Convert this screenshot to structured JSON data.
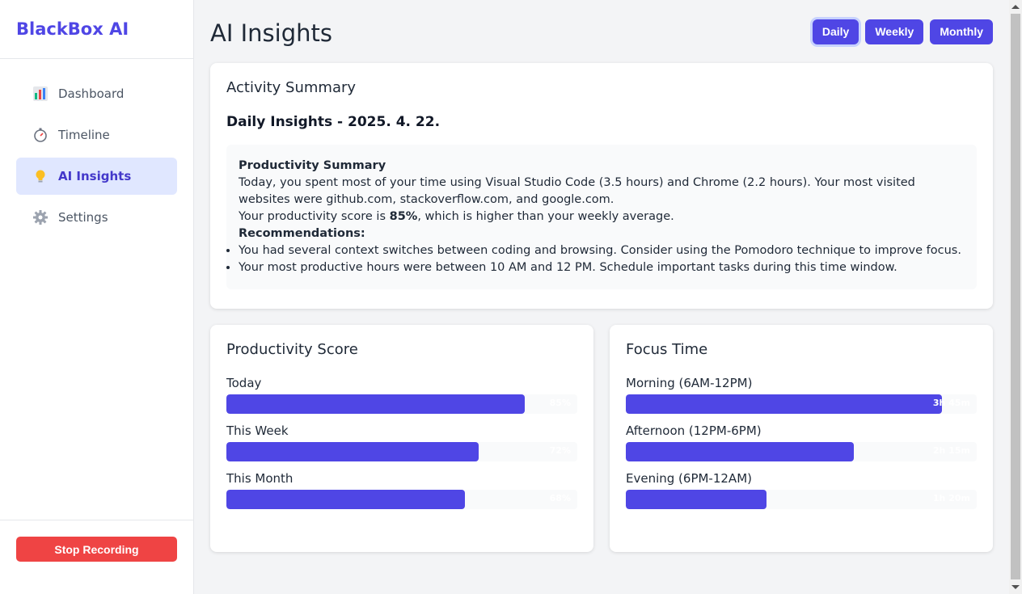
{
  "app": {
    "brand": "BlackBox AI"
  },
  "sidebar": {
    "items": [
      {
        "label": "Dashboard",
        "icon": "chart-icon",
        "active": false
      },
      {
        "label": "Timeline",
        "icon": "stopwatch-icon",
        "active": false
      },
      {
        "label": "AI Insights",
        "icon": "lightbulb-icon",
        "active": true
      },
      {
        "label": "Settings",
        "icon": "gear-icon",
        "active": false
      }
    ],
    "stop_label": "Stop Recording"
  },
  "header": {
    "title": "AI Insights",
    "periods": [
      "Daily",
      "Weekly",
      "Monthly"
    ],
    "active_period": "Daily"
  },
  "summary": {
    "title": "Activity Summary",
    "heading": "Daily Insights - 2025. 4. 22.",
    "prod_title": "Productivity Summary",
    "para1": "Today, you spent most of your time using Visual Studio Code (3.5 hours) and Chrome (2.2 hours). Your most visited websites were github.com, stackoverflow.com, and google.com.",
    "score_prefix": "Your productivity score is ",
    "score_value": "85%",
    "score_suffix": ", which is higher than your weekly average.",
    "rec_title": "Recommendations:",
    "recommendations": [
      "You had several context switches between coding and browsing. Consider using the Pomodoro technique to improve focus.",
      "Your most productive hours were between 10 AM and 12 PM. Schedule important tasks during this time window."
    ]
  },
  "productivity": {
    "title": "Productivity Score",
    "items": [
      {
        "label": "Today",
        "value_text": "85%",
        "fraction": 0.85
      },
      {
        "label": "This Week",
        "value_text": "72%",
        "fraction": 0.72
      },
      {
        "label": "This Month",
        "value_text": "68%",
        "fraction": 0.68
      }
    ]
  },
  "focus": {
    "title": "Focus Time",
    "items": [
      {
        "label": "Morning (6AM-12PM)",
        "value_text": "3h 45m",
        "fraction": 0.9
      },
      {
        "label": "Afternoon (12PM-6PM)",
        "value_text": "2h 15m",
        "fraction": 0.65
      },
      {
        "label": "Evening (6PM-12AM)",
        "value_text": "1h 20m",
        "fraction": 0.4
      }
    ]
  },
  "colors": {
    "accent": "#4f46e5",
    "danger": "#ef4444",
    "active_bg": "#e0e7ff"
  }
}
